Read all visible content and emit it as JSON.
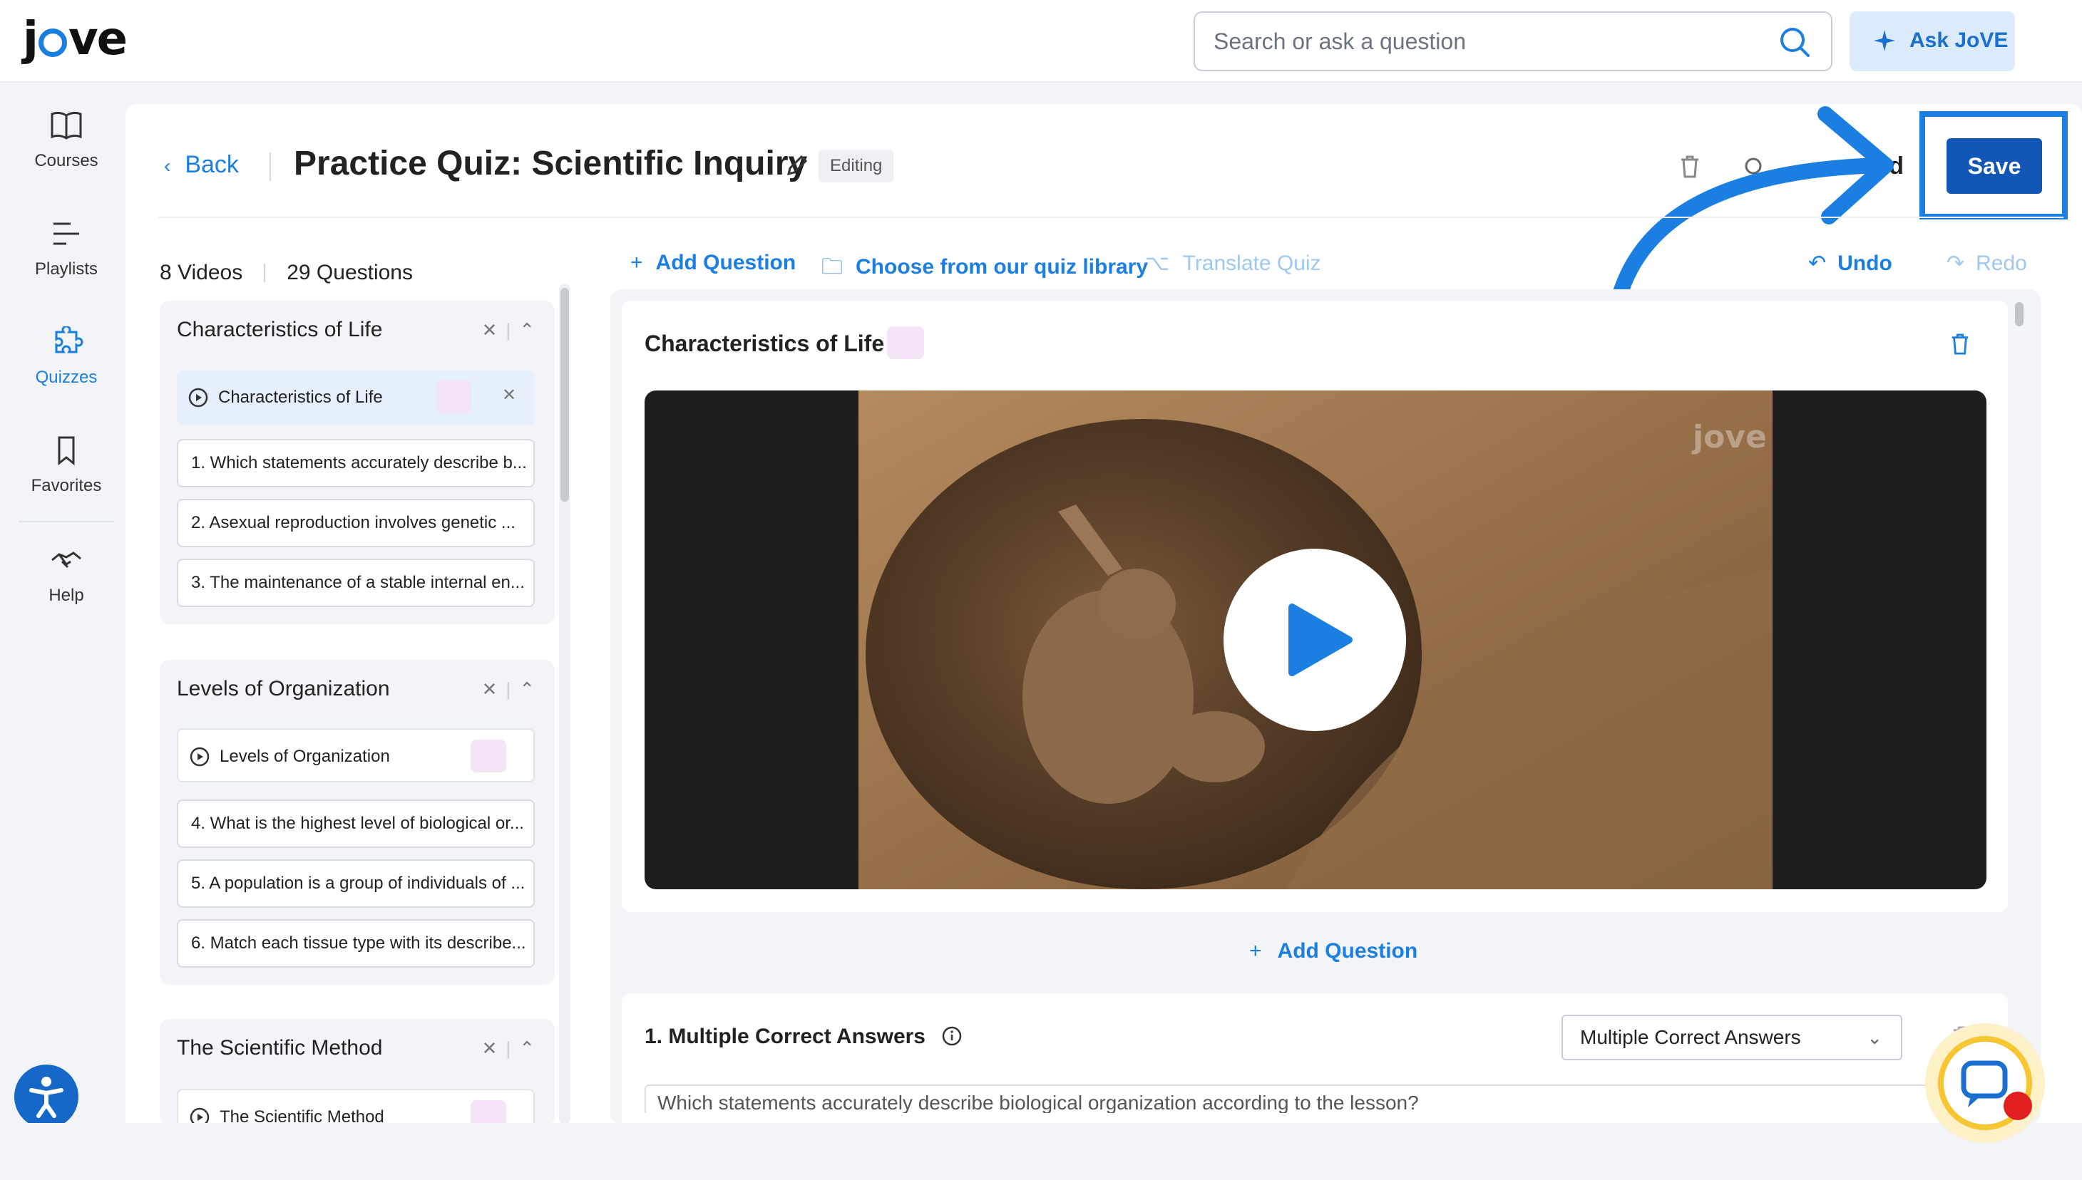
{
  "header": {
    "logo_text": "jove",
    "search_placeholder": "Search or ask a question",
    "ask_label": "Ask JoVE"
  },
  "nav": {
    "items": [
      {
        "label": "Courses",
        "icon": "book-icon",
        "active": false
      },
      {
        "label": "Playlists",
        "icon": "playlist-icon",
        "active": false
      },
      {
        "label": "Quizzes",
        "icon": "puzzle-icon",
        "active": true
      },
      {
        "label": "Favorites",
        "icon": "bookmark-icon",
        "active": false
      },
      {
        "label": "Help",
        "icon": "help-handshake-icon",
        "active": false
      }
    ]
  },
  "page": {
    "back_label": "Back",
    "title": "Practice Quiz: Scientific Inquiry",
    "status_badge": "Editing",
    "partial_label": "rd",
    "save_label": "Save"
  },
  "sidebar": {
    "videos_count": "8 Videos",
    "questions_count": "29 Questions",
    "groups": [
      {
        "title": "Characteristics of Life",
        "video": "Characteristics of Life",
        "questions": [
          "1. Which statements accurately describe b...",
          "2. Asexual reproduction involves genetic ...",
          "3. The maintenance of a stable internal en..."
        ]
      },
      {
        "title": "Levels of Organization",
        "video": "Levels of Organization",
        "questions": [
          "4. What is the highest level of biological or...",
          "5. A population is a group of individuals of ...",
          "6. Match each tissue type with its describe..."
        ]
      },
      {
        "title": "The Scientific Method",
        "video": "The Scientific Method",
        "questions": []
      }
    ]
  },
  "toolbar": {
    "add_question": "Add Question",
    "choose_library": "Choose from our quiz library",
    "translate": "Translate Quiz",
    "undo": "Undo",
    "redo": "Redo"
  },
  "content": {
    "section_title": "Characteristics of Life",
    "video_watermark": "jove",
    "add_question": "Add Question",
    "question": {
      "title": "1. Multiple Correct Answers",
      "type_selected": "Multiple Correct Answers",
      "text": "Which statements accurately describe biological organization according to the lesson?"
    }
  },
  "colors": {
    "accent": "#1a7fe0",
    "save": "#1257b8",
    "badge_pink": "#f3e4f6"
  }
}
